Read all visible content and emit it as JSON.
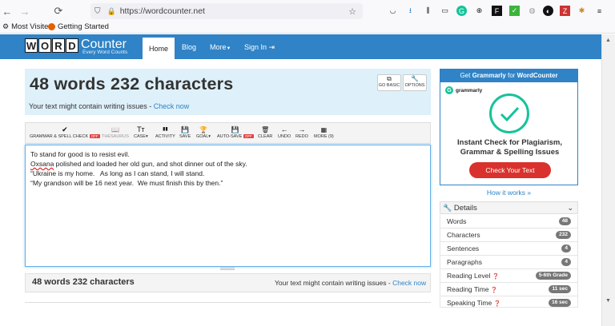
{
  "browser": {
    "url": "https://wordcounter.net",
    "bookmarks": [
      "Most Visited",
      "Getting Started"
    ]
  },
  "site": {
    "logo_letters": [
      "W",
      "O",
      "R",
      "D"
    ],
    "logo_counter": "Counter",
    "logo_sub": "Every Word Counts",
    "nav": {
      "home": "Home",
      "blog": "Blog",
      "more": "More",
      "signin": "Sign In"
    }
  },
  "header": {
    "title": "48 words 232 characters",
    "warning": "Your text might contain writing issues - ",
    "check_now": "Check now",
    "go_basic": [
      "GO BASIC"
    ],
    "options": "OPTIONS"
  },
  "toolbar": {
    "tools": [
      {
        "icon": "✔",
        "label": "GRAMMAR & SPELL CHECK",
        "badge": "OFF"
      },
      {
        "icon": "📖",
        "label": "THESAURUS"
      },
      {
        "icon": "Tт",
        "label": "CASE▾"
      },
      {
        "icon": "▮▮",
        "label": "ACTIVITY"
      },
      {
        "icon": "💾",
        "label": "SAVE"
      },
      {
        "icon": "🏆",
        "label": "GOAL▾"
      },
      {
        "icon": "💾",
        "label": "AUTO-SAVE",
        "badge": "OFF"
      },
      {
        "icon": "🗑",
        "label": "CLEAR"
      },
      {
        "icon": "←",
        "label": "UNDO"
      },
      {
        "icon": "→",
        "label": "REDO"
      },
      {
        "icon": "▦",
        "label": "MORE (9)"
      }
    ]
  },
  "editor": {
    "lines": [
      "To stand for good is to resist evil.",
      "Oxsana polished and loaded her old gun, and shot dinner out of the sky.",
      "“Ukraine is my home.   As long as I can stand, I will stand.",
      "“My grandson will be 16 next year.  We must finish this by then.”"
    ],
    "misspelled": "Oxsana"
  },
  "footer": {
    "count": "48 words 232 characters",
    "warning": "Your text might contain writing issues - ",
    "check_now": "Check now"
  },
  "ad": {
    "header_prefix": "Get ",
    "header_brand": "Grammarly",
    "header_suffix": " for ",
    "header_site": "WordCounter",
    "brand": "grammarly",
    "title": "Instant Check for Plagiarism, Grammar & Spelling Issues",
    "cta": "Check Your Text"
  },
  "how_it_works": "How it works »",
  "details": {
    "title": "Details",
    "rows": [
      {
        "label": "Words",
        "value": "48"
      },
      {
        "label": "Characters",
        "value": "232"
      },
      {
        "label": "Sentences",
        "value": "4"
      },
      {
        "label": "Paragraphs",
        "value": "4"
      },
      {
        "label": "Reading Level",
        "value": "5-6th Grade"
      },
      {
        "label": "Reading Time",
        "value": "11 sec"
      },
      {
        "label": "Speaking Time",
        "value": "16 sec"
      }
    ]
  },
  "colors": {
    "brand": "#2f83c6",
    "header_bg": "#def0f9",
    "grammarly": "#15c39a",
    "cta": "#d9312d"
  }
}
